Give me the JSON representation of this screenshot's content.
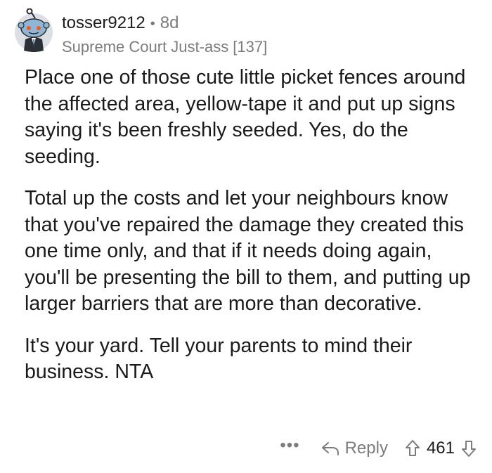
{
  "comment": {
    "author": "tosser9212",
    "separator": "•",
    "age": "8d",
    "flair": "Supreme Court Just-ass [137]",
    "paragraphs": [
      "Place one of those cute little picket fences around the affected area, yellow-tape it and put up signs saying it's been freshly seeded. Yes, do the seeding.",
      "Total up the costs and let your neighbours know that you've repaired the damage they created this one time only, and that if it needs doing again, you'll be presenting the bill to them, and putting up larger barriers that are more than decorative.",
      "It's your yard. Tell your parents to mind their business. NTA"
    ]
  },
  "actions": {
    "more": "•••",
    "reply": "Reply",
    "score": "461"
  },
  "icons": {
    "avatar": "snoo-avatar-icon",
    "more": "more-options-icon",
    "reply": "reply-arrow-icon",
    "upvote": "upvote-arrow-icon",
    "downvote": "downvote-arrow-icon"
  },
  "colors": {
    "text": "#1a1a1b",
    "muted": "#7c7c7c",
    "avatar_bg": "#dae0e6",
    "avatar_face": "#8fb6d6"
  }
}
